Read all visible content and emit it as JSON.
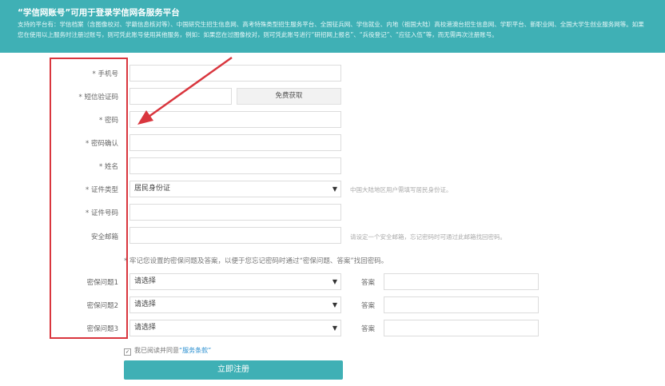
{
  "banner": {
    "title": "“学信网账号”可用于登录学信网各服务平台",
    "description": "支持的平台有：学信档案（含图像校对、学籍信息核对等）、中国研究生招生信息网、高考特殊类型招生服务平台、全国征兵网、学信就业、内地（祖国大陆）高校港澳台招生信息网、学职平台、新职业网、全国大学生创业服务网等。如果您在使用以上服务时注册过账号，则可凭此账号使用其他服务，例如：如果您在过图像校对，则可凭此账号进行“研招网上报名”、“兵役登记”、“应征入伍”等，而无需再次注册账号。"
  },
  "form": {
    "phone_label": "* 手机号",
    "sms_label": "* 短信验证码",
    "sms_button": "免费获取",
    "password_label": "* 密码",
    "confirm_label": "* 密码确认",
    "name_label": "* 姓名",
    "idtype_label": "* 证件类型",
    "idtype_value": "居民身份证",
    "idtype_hint": "中国大陆地区用户需填写居民身份证。",
    "idnum_label": "* 证件号码",
    "email_label": "安全邮箱",
    "email_hint": "请设定一个安全邮箱，忘记密码时可通过此邮箱找回密码。",
    "security_notice": "* 牢记您设置的密保问题及答案，以便于您忘记密码时通过“密保问题、答案”找回密码。",
    "questions": [
      {
        "label": "密保问题1",
        "value": "请选择",
        "answer_label": "答案"
      },
      {
        "label": "密保问题2",
        "value": "请选择",
        "answer_label": "答案"
      },
      {
        "label": "密保问题3",
        "value": "请选择",
        "answer_label": "答案"
      }
    ],
    "agree_text": "我已阅读并同意",
    "terms_link": "“服务条款”",
    "register_button": "立即注册"
  },
  "colors": {
    "accent": "#3fb0b5",
    "annotation": "#d9363e",
    "link": "#2a8fd0"
  }
}
